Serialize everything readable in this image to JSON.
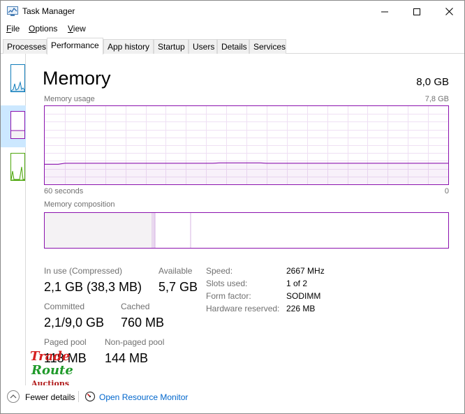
{
  "window": {
    "title": "Task Manager"
  },
  "menu": [
    {
      "label": "File",
      "accel": "F",
      "rest": "ile"
    },
    {
      "label": "Options",
      "accel": "O",
      "rest": "ptions"
    },
    {
      "label": "View",
      "accel": "V",
      "rest": "iew"
    }
  ],
  "tabs": [
    {
      "label": "Processes",
      "active": false
    },
    {
      "label": "Performance",
      "active": true
    },
    {
      "label": "App history",
      "active": false
    },
    {
      "label": "Startup",
      "active": false
    },
    {
      "label": "Users",
      "active": false
    },
    {
      "label": "Details",
      "active": false
    },
    {
      "label": "Services",
      "active": false
    }
  ],
  "memory": {
    "title": "Memory",
    "total": "8,0 GB",
    "usage_label": "Memory usage",
    "usage_max": "7,8 GB",
    "x_left": "60 seconds",
    "x_right": "0",
    "composition_label": "Memory composition",
    "usage_fraction": 0.27
  },
  "stats": {
    "in_use_label": "In use (Compressed)",
    "in_use_value": "2,1 GB (38,3 MB)",
    "available_label": "Available",
    "available_value": "5,7 GB",
    "committed_label": "Committed",
    "committed_value": "2,1/9,0 GB",
    "cached_label": "Cached",
    "cached_value": "760 MB",
    "paged_label": "Paged pool",
    "paged_value": "118 MB",
    "nonpaged_label": "Non-paged pool",
    "nonpaged_value": "144 MB"
  },
  "details": [
    {
      "label": "Speed:",
      "value": "2667 MHz"
    },
    {
      "label": "Slots used:",
      "value": "1 of 2"
    },
    {
      "label": "Form factor:",
      "value": "SODIMM"
    },
    {
      "label": "Hardware reserved:",
      "value": "226 MB"
    }
  ],
  "footer": {
    "fewer_details": "Fewer details",
    "fewer_accel": "d",
    "open_resource_monitor": "Open Resource Monitor"
  },
  "watermark": {
    "line1": "Trade",
    "line2": "Route",
    "line3": "Auctions"
  },
  "colors": {
    "memory_accent": "#8b12ae",
    "cpu_accent": "#117dbb",
    "disk_accent": "#4da60c",
    "selection": "#cce8ff"
  }
}
